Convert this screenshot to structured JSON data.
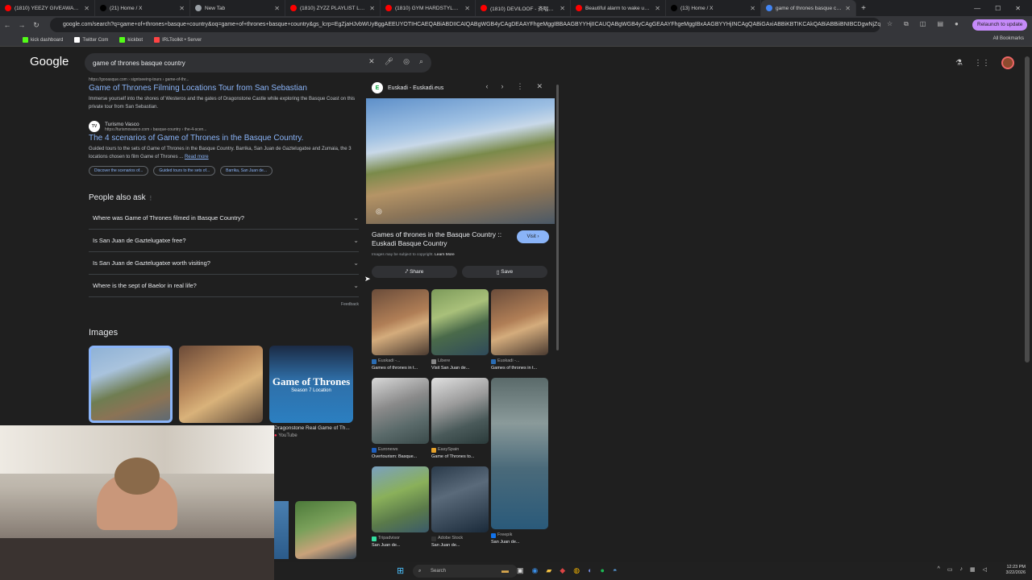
{
  "tabs": [
    {
      "title": "(1810) YEEZY GIVEAWAY!!! | 67",
      "fav": "#ff0000"
    },
    {
      "title": "(21) Home / X",
      "fav": "#000000"
    },
    {
      "title": "New Tab",
      "fav": "#9aa0a6"
    },
    {
      "title": "(1810) ZYZZ PLAYLIST LEGEND",
      "fav": "#ff0000"
    },
    {
      "title": "(1810) GYM HARDSTYLE 😮 - I",
      "fav": "#ff0000"
    },
    {
      "title": "(1810) DEVILOOF - 斉唱歌唱",
      "fav": "#ff0000"
    },
    {
      "title": "Beautiful alarm to wake up to",
      "fav": "#ff0000"
    },
    {
      "title": "(13) Home / X",
      "fav": "#000000"
    },
    {
      "title": "game of thrones basque country",
      "fav": "#4285f4"
    }
  ],
  "address": {
    "url": "google.com/search?q=game+of+thrones+basque+country&oq=game+of+thrones+basque+country&gs_lcrp=EgZjaHJvbWUyBggAEEUYOTIHCAEQABiABDIICAIQABgWGB4yCAgDEAAYFhgeMggIBBAAGBYYHjIICAUQABgWGB4yCAgGEAAYFhgeMggIBxAAGBYYHjINCAgQABiGAxiABBiKBTIKCAkQABiABBiiBNIBCDgwNjZqMA",
    "relaunch": "Relaunch to update"
  },
  "bookmarks": [
    {
      "label": "kick dashboard",
      "color": "#53fc18"
    },
    {
      "label": "Twitter Com",
      "color": "#ffffff"
    },
    {
      "label": "kickbot",
      "color": "#53fc18"
    },
    {
      "label": "IRLToolkit • Server",
      "color": "#ff4444"
    }
  ],
  "all_bookmarks": "All Bookmarks",
  "google": {
    "logo": "Google",
    "query": "game of thrones basque country"
  },
  "results": [
    {
      "url": "https://gooasque.com › signtseeing-tours › game-of-thr...",
      "title": "Game of Thrones Filming Locations Tour from San Sebastian",
      "snippet": "Immerse yourself into the shores of Westeros and the gates of Dragonstone Castle while exploring the Basque Coast on this private tour from San Sebastian."
    },
    {
      "site": "Turismo Vasco",
      "url": "https://turismovasco.com › basque-country › the-4-scen...",
      "title": "The 4 scenarios of Game of Thrones in the Basque Country.",
      "snippet": "Guided tours to the sets of Game of Thrones in the Basque Country. Barrika, San Juan de Gaztelugatxe and Zumaia, the 3 locations chosen to film Game of Thrones ...",
      "readmore": "Read more",
      "chips": [
        "Discover the scenarios of...",
        "Guided tours to the sets of...",
        "Barrika, San Juan de..."
      ]
    }
  ],
  "paa": {
    "title": "People also ask",
    "questions": [
      "Where was Game of Thrones filmed in Basque Country?",
      "Is San Juan de Gaztelugatxe free?",
      "Is San Juan de Gaztelugatxe worth visiting?",
      "Where is the sept of Baelor in real life?"
    ],
    "feedback": "Feedback"
  },
  "images": {
    "title": "Images",
    "caption": "Dragonstone Real Game of Th...",
    "source": "YouTube",
    "overlay_title": "Game of Thrones",
    "overlay_sub": "Season 7 Location"
  },
  "panel": {
    "site": "Euskadi - Euskadi.eus",
    "title": "Games of thrones in the Basque Country :: Euskadi Basque Country",
    "visit": "Visit",
    "copyright": "Images may be subject to copyright.",
    "learn": "Learn More",
    "share": "Share",
    "save": "Save",
    "related": [
      {
        "src": "Euskadi -...",
        "t": "Games of thrones in t...",
        "c": "#2a6db5"
      },
      {
        "src": "Libere",
        "t": "Visit San Juan de...",
        "c": "#888888"
      },
      {
        "src": "Euskadi -...",
        "t": "Games of thrones in t...",
        "c": "#2a6db5"
      },
      {
        "src": "Euronews",
        "t": "Overtourism: Basque...",
        "c": "#1d5fbf"
      },
      {
        "src": "EasySpain",
        "t": "Game of Thrones to...",
        "c": "#e8a32a"
      },
      {
        "src": "Freepik",
        "t": "San Juan de...",
        "c": "#1273eb"
      },
      {
        "src": "Tripadvisor",
        "t": "San Juan de...",
        "c": "#34e0a1"
      },
      {
        "src": "Adobe Stock",
        "t": "San Juan de...",
        "c": "#333333"
      }
    ]
  },
  "taskbar": {
    "search": "Search",
    "time": "12:23 PM",
    "date": "3/22/2026"
  }
}
